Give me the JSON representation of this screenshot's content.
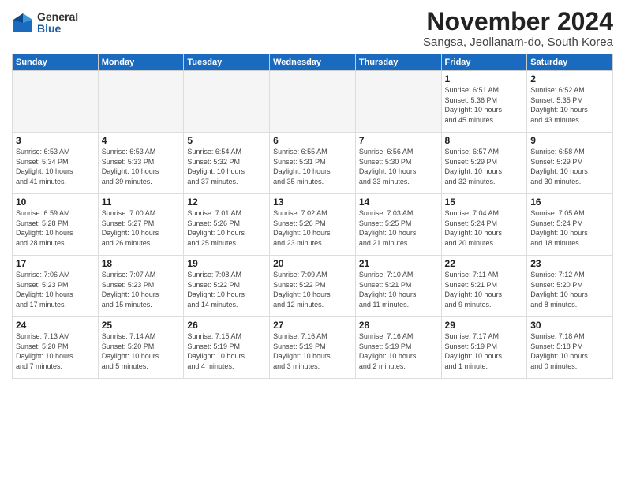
{
  "logo": {
    "general": "General",
    "blue": "Blue"
  },
  "title": "November 2024",
  "location": "Sangsa, Jeollanam-do, South Korea",
  "days_header": [
    "Sunday",
    "Monday",
    "Tuesday",
    "Wednesday",
    "Thursday",
    "Friday",
    "Saturday"
  ],
  "weeks": [
    [
      {
        "num": "",
        "info": ""
      },
      {
        "num": "",
        "info": ""
      },
      {
        "num": "",
        "info": ""
      },
      {
        "num": "",
        "info": ""
      },
      {
        "num": "",
        "info": ""
      },
      {
        "num": "1",
        "info": "Sunrise: 6:51 AM\nSunset: 5:36 PM\nDaylight: 10 hours\nand 45 minutes."
      },
      {
        "num": "2",
        "info": "Sunrise: 6:52 AM\nSunset: 5:35 PM\nDaylight: 10 hours\nand 43 minutes."
      }
    ],
    [
      {
        "num": "3",
        "info": "Sunrise: 6:53 AM\nSunset: 5:34 PM\nDaylight: 10 hours\nand 41 minutes."
      },
      {
        "num": "4",
        "info": "Sunrise: 6:53 AM\nSunset: 5:33 PM\nDaylight: 10 hours\nand 39 minutes."
      },
      {
        "num": "5",
        "info": "Sunrise: 6:54 AM\nSunset: 5:32 PM\nDaylight: 10 hours\nand 37 minutes."
      },
      {
        "num": "6",
        "info": "Sunrise: 6:55 AM\nSunset: 5:31 PM\nDaylight: 10 hours\nand 35 minutes."
      },
      {
        "num": "7",
        "info": "Sunrise: 6:56 AM\nSunset: 5:30 PM\nDaylight: 10 hours\nand 33 minutes."
      },
      {
        "num": "8",
        "info": "Sunrise: 6:57 AM\nSunset: 5:29 PM\nDaylight: 10 hours\nand 32 minutes."
      },
      {
        "num": "9",
        "info": "Sunrise: 6:58 AM\nSunset: 5:29 PM\nDaylight: 10 hours\nand 30 minutes."
      }
    ],
    [
      {
        "num": "10",
        "info": "Sunrise: 6:59 AM\nSunset: 5:28 PM\nDaylight: 10 hours\nand 28 minutes."
      },
      {
        "num": "11",
        "info": "Sunrise: 7:00 AM\nSunset: 5:27 PM\nDaylight: 10 hours\nand 26 minutes."
      },
      {
        "num": "12",
        "info": "Sunrise: 7:01 AM\nSunset: 5:26 PM\nDaylight: 10 hours\nand 25 minutes."
      },
      {
        "num": "13",
        "info": "Sunrise: 7:02 AM\nSunset: 5:26 PM\nDaylight: 10 hours\nand 23 minutes."
      },
      {
        "num": "14",
        "info": "Sunrise: 7:03 AM\nSunset: 5:25 PM\nDaylight: 10 hours\nand 21 minutes."
      },
      {
        "num": "15",
        "info": "Sunrise: 7:04 AM\nSunset: 5:24 PM\nDaylight: 10 hours\nand 20 minutes."
      },
      {
        "num": "16",
        "info": "Sunrise: 7:05 AM\nSunset: 5:24 PM\nDaylight: 10 hours\nand 18 minutes."
      }
    ],
    [
      {
        "num": "17",
        "info": "Sunrise: 7:06 AM\nSunset: 5:23 PM\nDaylight: 10 hours\nand 17 minutes."
      },
      {
        "num": "18",
        "info": "Sunrise: 7:07 AM\nSunset: 5:23 PM\nDaylight: 10 hours\nand 15 minutes."
      },
      {
        "num": "19",
        "info": "Sunrise: 7:08 AM\nSunset: 5:22 PM\nDaylight: 10 hours\nand 14 minutes."
      },
      {
        "num": "20",
        "info": "Sunrise: 7:09 AM\nSunset: 5:22 PM\nDaylight: 10 hours\nand 12 minutes."
      },
      {
        "num": "21",
        "info": "Sunrise: 7:10 AM\nSunset: 5:21 PM\nDaylight: 10 hours\nand 11 minutes."
      },
      {
        "num": "22",
        "info": "Sunrise: 7:11 AM\nSunset: 5:21 PM\nDaylight: 10 hours\nand 9 minutes."
      },
      {
        "num": "23",
        "info": "Sunrise: 7:12 AM\nSunset: 5:20 PM\nDaylight: 10 hours\nand 8 minutes."
      }
    ],
    [
      {
        "num": "24",
        "info": "Sunrise: 7:13 AM\nSunset: 5:20 PM\nDaylight: 10 hours\nand 7 minutes."
      },
      {
        "num": "25",
        "info": "Sunrise: 7:14 AM\nSunset: 5:20 PM\nDaylight: 10 hours\nand 5 minutes."
      },
      {
        "num": "26",
        "info": "Sunrise: 7:15 AM\nSunset: 5:19 PM\nDaylight: 10 hours\nand 4 minutes."
      },
      {
        "num": "27",
        "info": "Sunrise: 7:16 AM\nSunset: 5:19 PM\nDaylight: 10 hours\nand 3 minutes."
      },
      {
        "num": "28",
        "info": "Sunrise: 7:16 AM\nSunset: 5:19 PM\nDaylight: 10 hours\nand 2 minutes."
      },
      {
        "num": "29",
        "info": "Sunrise: 7:17 AM\nSunset: 5:19 PM\nDaylight: 10 hours\nand 1 minute."
      },
      {
        "num": "30",
        "info": "Sunrise: 7:18 AM\nSunset: 5:18 PM\nDaylight: 10 hours\nand 0 minutes."
      }
    ]
  ]
}
